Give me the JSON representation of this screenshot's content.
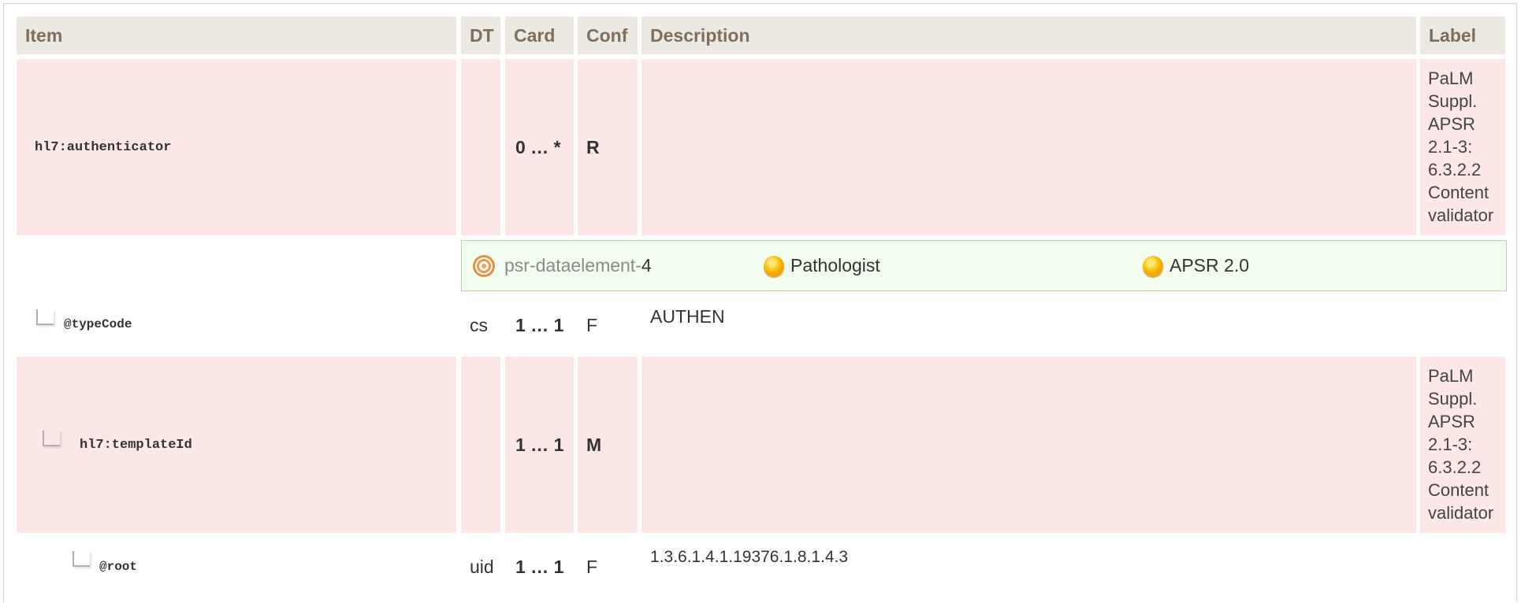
{
  "header": {
    "item": "Item",
    "dt": "DT",
    "card": "Card",
    "conf": "Conf",
    "description": "Description",
    "label": "Label"
  },
  "rows": [
    {
      "item": "hl7:authenticator",
      "dt": "",
      "card": "0 … *",
      "conf": "R",
      "description": "",
      "label": "PaLM Suppl. APSR 2.1-3: 6.3.2.2 Content validator"
    },
    {
      "item": "@typeCode",
      "dt": "cs",
      "card": "1 … 1",
      "conf": "F",
      "description": "AUTHEN",
      "label": ""
    },
    {
      "item": "hl7:templateId",
      "dt": "",
      "card": "1 … 1",
      "conf": "M",
      "description": "",
      "label": "PaLM Suppl. APSR 2.1-3: 6.3.2.2 Content validator"
    },
    {
      "item": "@root",
      "dt": "uid",
      "card": "1 … 1",
      "conf": "F",
      "description": "1.3.6.1.4.1.19376.1.8.1.4.3",
      "label": ""
    }
  ],
  "association": {
    "concept_prefix": "psr-dataelement-",
    "concept_number": "4",
    "item2": "Pathologist",
    "item3": "APSR 2.0",
    "icons": [
      "target-icon",
      "status-dot-icon",
      "status-dot-icon"
    ],
    "colors": {
      "background": "#f2fdf0",
      "border": "#b6d3a6",
      "link": "#8a8a8a"
    }
  },
  "colors": {
    "header_bg": "#ece9e3",
    "header_text": "#7e6e5a",
    "row_highlight": "#fde7e7"
  }
}
